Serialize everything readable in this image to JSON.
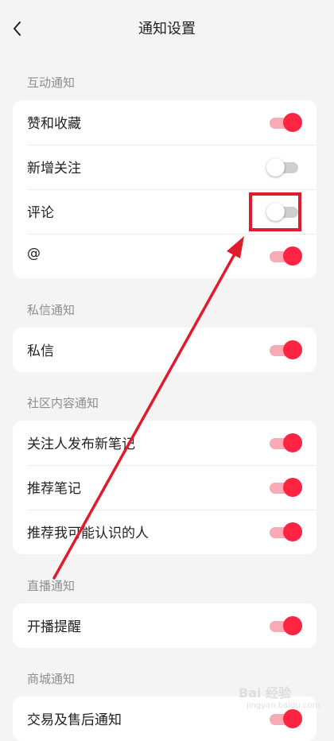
{
  "header": {
    "title": "通知设置",
    "back_icon": "chevron-left-icon"
  },
  "sections": [
    {
      "title": "互动通知",
      "items": [
        {
          "label": "赞和收藏",
          "enabled": true
        },
        {
          "label": "新增关注",
          "enabled": false
        },
        {
          "label": "评论",
          "enabled": false
        },
        {
          "label": "@",
          "enabled": true
        }
      ]
    },
    {
      "title": "私信通知",
      "items": [
        {
          "label": "私信",
          "enabled": true
        }
      ]
    },
    {
      "title": "社区内容通知",
      "items": [
        {
          "label": "关注人发布新笔记",
          "enabled": true
        },
        {
          "label": "推荐笔记",
          "enabled": true
        },
        {
          "label": "推荐我可能认识的人",
          "enabled": true
        }
      ]
    },
    {
      "title": "直播通知",
      "items": [
        {
          "label": "开播提醒",
          "enabled": true
        }
      ]
    },
    {
      "title": "商城通知",
      "items": [
        {
          "label": "交易及售后通知",
          "enabled": true
        }
      ]
    }
  ],
  "colors": {
    "accent": "#ff2442",
    "toggle_on_track": "#f8aab5",
    "toggle_off_track": "#cfcfcf",
    "annotation": "#e01b2c"
  },
  "watermark": {
    "main": "Bai 经验",
    "sub": "jingyan.baidu.com"
  }
}
